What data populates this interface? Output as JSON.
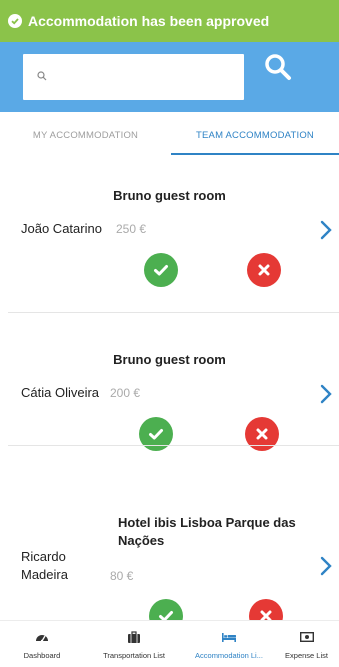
{
  "toast": {
    "message": "Accommodation has been approved",
    "icon": "check-circle-icon",
    "color": "#8bc34a"
  },
  "search": {
    "placeholder": "",
    "value": "",
    "bar_color": "#5aa9e6",
    "button_icon": "search-icon"
  },
  "tabs": [
    {
      "label": "MY ACCOMMODATION",
      "active": false
    },
    {
      "label": "TEAM ACCOMMODATION",
      "active": true
    }
  ],
  "accent": "#2f83c5",
  "accommodations": [
    {
      "title": "Bruno guest room",
      "person": "João Catarino",
      "price": "250 €"
    },
    {
      "title": "Bruno guest room",
      "person": "Cátia Oliveira",
      "price": "200 €"
    },
    {
      "title": "Hotel ibis Lisboa Parque das Nações",
      "person": "Ricardo Madeira",
      "price": "80 €"
    }
  ],
  "actions": {
    "approve_icon": "check-icon",
    "reject_icon": "close-icon",
    "approve_color": "#4caf50",
    "reject_color": "#e53935"
  },
  "bottom_nav": [
    {
      "label": "Dashboard",
      "icon": "dashboard-icon",
      "active": false
    },
    {
      "label": "Transportation List",
      "icon": "briefcase-icon",
      "active": false
    },
    {
      "label": "Accommodation Li...",
      "icon": "bed-icon",
      "active": true
    },
    {
      "label": "Expense List",
      "icon": "money-icon",
      "active": false
    }
  ]
}
